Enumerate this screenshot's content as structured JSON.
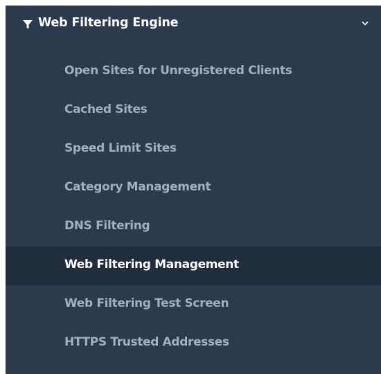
{
  "menu": {
    "title": "Web Filtering Engine",
    "icon": "filter-icon",
    "expand_icon": "chevron-down-icon",
    "colors": {
      "background": "#2b3a4c",
      "active_background": "#202d3d",
      "item_text": "#a4afbe",
      "active_text": "#ffffff"
    },
    "items": [
      {
        "label": "Open Sites for Unregistered Clients",
        "active": false
      },
      {
        "label": "Cached Sites",
        "active": false
      },
      {
        "label": "Speed Limit Sites",
        "active": false
      },
      {
        "label": "Category Management",
        "active": false
      },
      {
        "label": "DNS Filtering",
        "active": false
      },
      {
        "label": "Web Filtering Management",
        "active": true
      },
      {
        "label": "Web Filtering Test Screen",
        "active": false
      },
      {
        "label": "HTTPS Trusted Addresses",
        "active": false
      }
    ]
  }
}
